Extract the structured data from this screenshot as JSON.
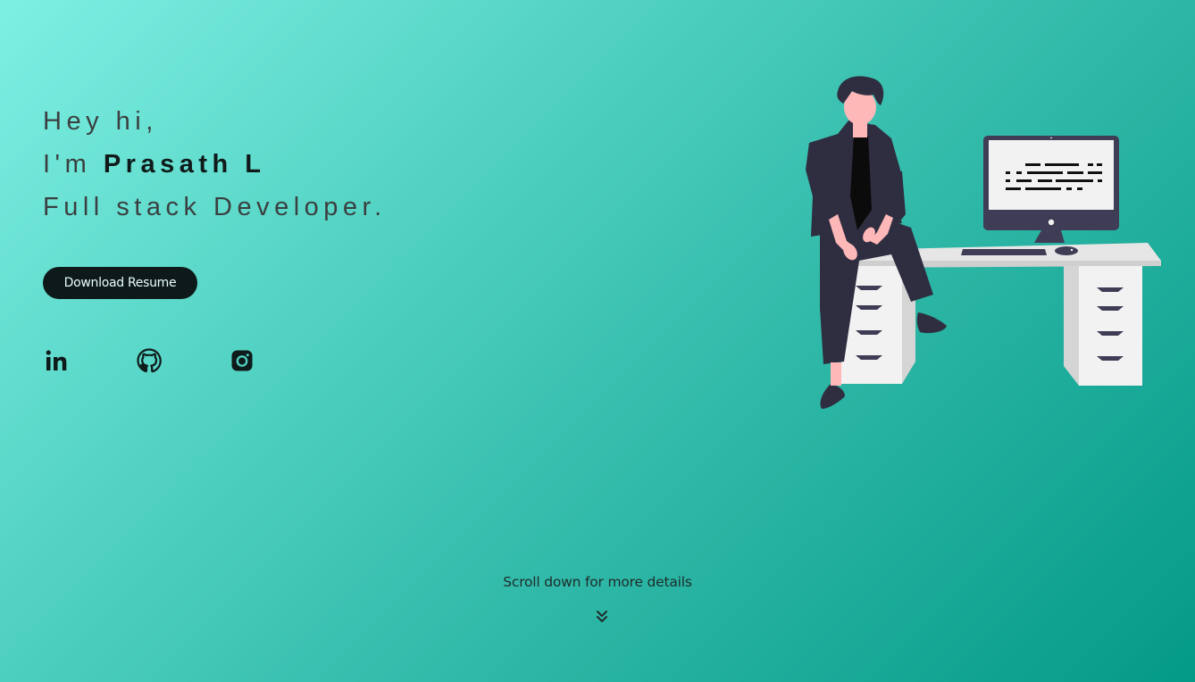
{
  "hero": {
    "greeting": "Hey hi,",
    "intro_prefix": "I'm ",
    "name": "Prasath L",
    "role": "Full stack Developer."
  },
  "actions": {
    "download_resume_label": "Download Resume"
  },
  "socials": [
    {
      "icon": "linkedin-icon"
    },
    {
      "icon": "github-icon"
    },
    {
      "icon": "instagram-icon"
    }
  ],
  "footer": {
    "scroll_hint": "Scroll down for more details",
    "scroll_icon": "double-chevron-down-icon"
  },
  "colors": {
    "gradient_start": "#7eefe3",
    "gradient_end": "#049a88",
    "button_bg": "#0e1a1a",
    "text_dark": "#101a1a"
  }
}
